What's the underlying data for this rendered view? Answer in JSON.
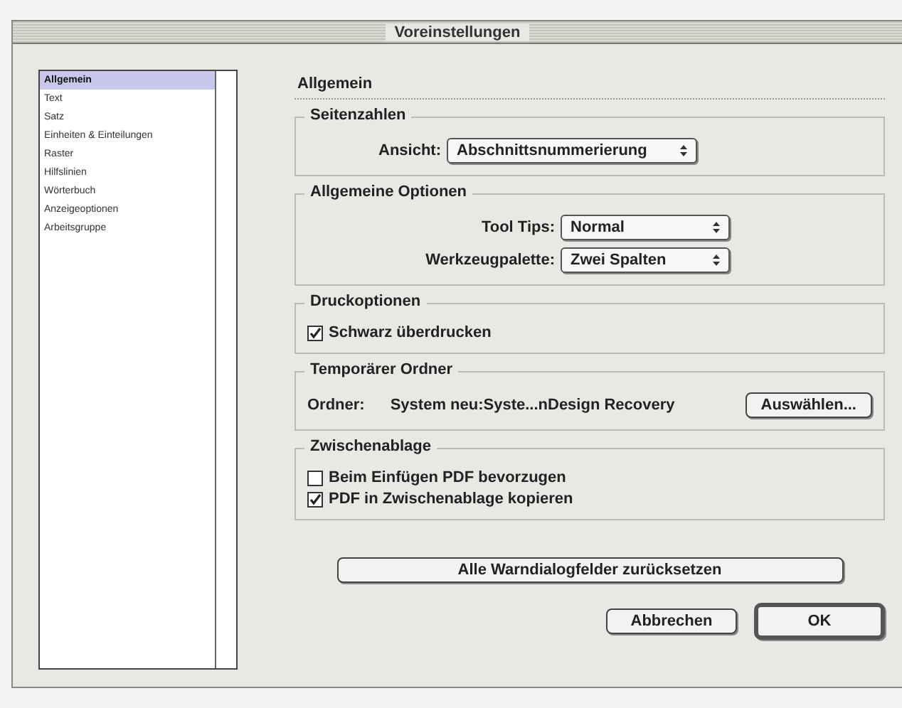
{
  "window": {
    "title": "Voreinstellungen"
  },
  "sidebar": {
    "items": [
      {
        "label": "Allgemein",
        "selected": true
      },
      {
        "label": "Text",
        "selected": false
      },
      {
        "label": "Satz",
        "selected": false
      },
      {
        "label": "Einheiten & Einteilungen",
        "selected": false
      },
      {
        "label": "Raster",
        "selected": false
      },
      {
        "label": "Hilfslinien",
        "selected": false
      },
      {
        "label": "Wörterbuch",
        "selected": false
      },
      {
        "label": "Anzeigeoptionen",
        "selected": false
      },
      {
        "label": "Arbeitsgruppe",
        "selected": false
      }
    ]
  },
  "panel": {
    "title": "Allgemein",
    "groups": [
      {
        "title": "Seitenzahlen",
        "kind": "popups",
        "rows": [
          {
            "label": "Ansicht:",
            "value": "Abschnittsnummerierung"
          }
        ]
      },
      {
        "title": "Allgemeine Optionen",
        "kind": "popups",
        "rows": [
          {
            "label": "Tool Tips:",
            "value": "Normal"
          },
          {
            "label": "Werkzeugpalette:",
            "value": "Zwei Spalten"
          }
        ]
      },
      {
        "title": "Druckoptionen",
        "kind": "checkboxes",
        "items": [
          {
            "label": "Schwarz überdrucken",
            "checked": true
          }
        ]
      },
      {
        "title": "Temporärer Ordner",
        "kind": "folder",
        "label": "Ordner:",
        "path": "System neu:Syste...nDesign Recovery",
        "button": "Auswählen..."
      },
      {
        "title": "Zwischenablage",
        "kind": "checkboxes",
        "items": [
          {
            "label": "Beim Einfügen PDF bevorzugen",
            "checked": false
          },
          {
            "label": "PDF in Zwischenablage kopieren",
            "checked": true
          }
        ]
      }
    ]
  },
  "reset_button": "Alle Warndialogfelder zurücksetzen",
  "buttons": [
    {
      "label": "Abbrechen",
      "default": false
    },
    {
      "label": "OK",
      "default": true
    }
  ]
}
